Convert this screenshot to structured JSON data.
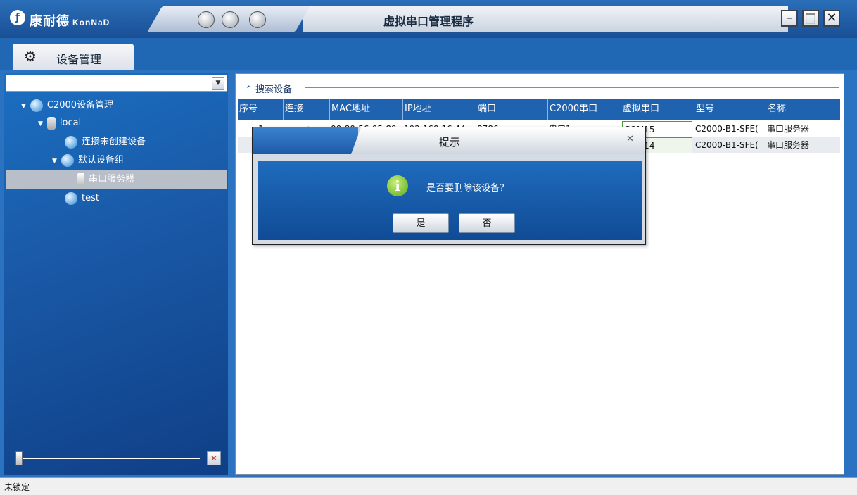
{
  "app": {
    "logo_text": "康耐德",
    "logo_sub": "KonNaD",
    "title": "虚拟串口管理程序"
  },
  "tab": {
    "label": "设备管理"
  },
  "tree": {
    "root": "C2000设备管理",
    "local": "local",
    "uncreated": "连接未创建设备",
    "default_group": "默认设备组",
    "serial_server": "串口服务器",
    "test": "test"
  },
  "section": {
    "title": "搜索设备"
  },
  "table": {
    "columns": [
      "序号",
      "连接",
      "MAC地址",
      "IP地址",
      "端口",
      "C2000串口",
      "虚拟串口",
      "型号",
      "名称"
    ],
    "rows": [
      {
        "index": "1",
        "conn": "✓",
        "mac": "00-80-56-05-89",
        "ip": "192.168.16.44",
        "port": "8786",
        "c2000_port": "串口1",
        "virtual_port": "COM15",
        "model": "C2000-B1-SFE(",
        "name": "串口服务器"
      },
      {
        "index": "",
        "conn": "",
        "mac": "",
        "ip": "",
        "port": "",
        "c2000_port": "",
        "virtual_port": "COM14",
        "model": "C2000-B1-SFE(",
        "name": "串口服务器"
      }
    ]
  },
  "dialog": {
    "title": "提示",
    "message": "是否要删除该设备？",
    "yes": "是",
    "no": "否"
  },
  "status": {
    "text": "未锁定"
  }
}
